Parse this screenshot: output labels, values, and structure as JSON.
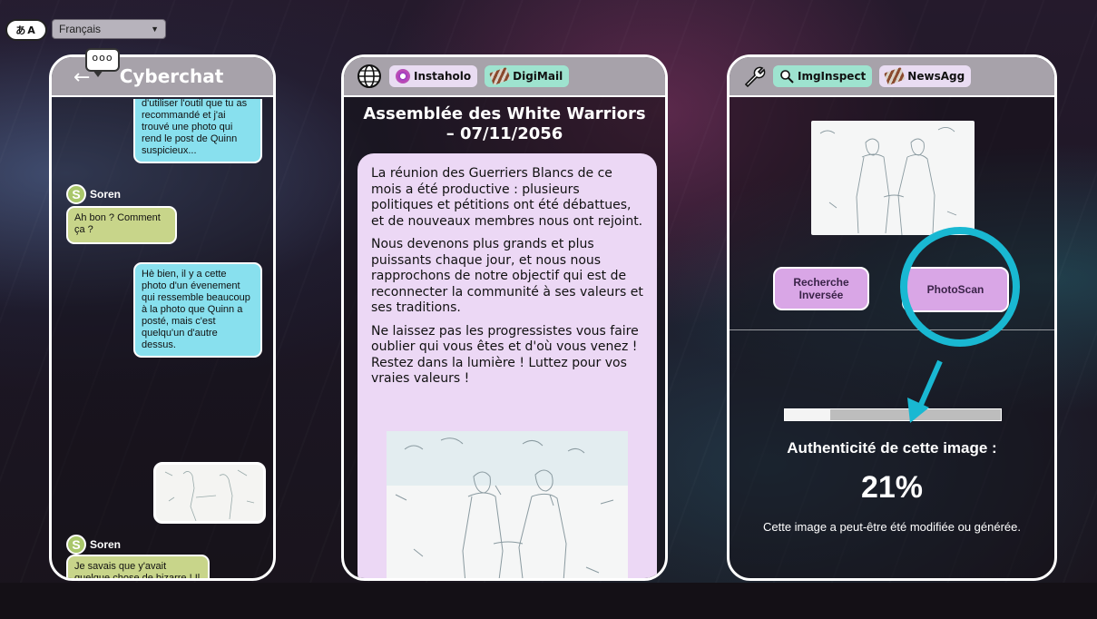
{
  "language": {
    "icon": "translate-icon",
    "icon_text": "あA",
    "selected": "Français"
  },
  "chat": {
    "title": "Cyberchat",
    "speech_icon_text": "ooo",
    "messages": [
      {
        "from": "me",
        "text": "d'utiliser l'outil que tu as recommandé et j'ai trouvé une photo qui rend le post de Quinn suspicieux..."
      },
      {
        "from": "Soren",
        "text": "Ah bon ? Comment ça ?"
      },
      {
        "from": "me",
        "text": "Hè bien, il y a cette photo d'un évenement qui ressemble beaucoup à la photo que Quinn a posté, mais c'est quelqu'un d'autre dessus."
      },
      {
        "from": "Soren",
        "text": "Je savais que y'avait quelque chose de bizarre ! Il faut le montrer aux autres !"
      }
    ],
    "sender_name": "Soren",
    "avatar_letter": "S"
  },
  "news": {
    "tabs": [
      {
        "label": "Instaholo",
        "icon": "instaholo-icon"
      },
      {
        "label": "DigiMail",
        "icon": "digimail-icon"
      }
    ],
    "title_line1": "Assemblée des White Warriors",
    "title_line2": "– 07/11/2056",
    "paragraphs": [
      "La réunion des Guerriers Blancs de ce mois a été productive : plusieurs politiques et pétitions ont été débattues, et de nouveaux membres nous ont rejoint.",
      "Nous devenons plus grands et plus puissants chaque jour, et nous nous rapprochons de notre objectif qui est de reconnecter la communité à ses valeurs et ses traditions.",
      "Ne laissez pas les progressistes vous faire oublier qui vous êtes et d'où vous venez ! Restez dans la lumière ! Luttez pour vos vraies valeurs !"
    ]
  },
  "tools": {
    "tabs": [
      {
        "label": "ImgInspect",
        "icon": "magnifier-icon"
      },
      {
        "label": "NewsAgg",
        "icon": "newsagg-icon"
      }
    ],
    "reverse_search_line1": "Recherche",
    "reverse_search_line2": "Inversée",
    "photoscan_label": "PhotoScan",
    "progress_fraction": 0.21,
    "authenticity_label": "Authenticité de cette image :",
    "authenticity_value": "21%",
    "note": "Cette image a peut-être été modifiée ou générée."
  },
  "colors": {
    "highlight": "#19b8d2",
    "me_bubble": "#88e0ee",
    "other_bubble": "#c8d58a",
    "tool_button": "#d9a6e6"
  }
}
